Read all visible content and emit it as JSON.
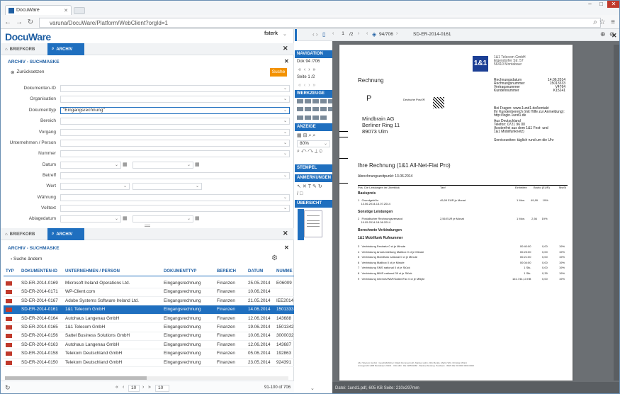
{
  "browser": {
    "tab_title": "DocuWare",
    "url": "varuna/DocuWare/Platform/WebClient?orgId=1"
  },
  "app": {
    "logo": "DocuWare",
    "user": "fsterk"
  },
  "top_tabs": {
    "inbox": "BRIEFKORB",
    "archive": "ARCHIV"
  },
  "search": {
    "title": "ARCHIV - SUCHMASKE",
    "reset": "Zurücksetzen",
    "search_button": "Suche",
    "fields": [
      {
        "label": "Dokumenten-ID",
        "value": ""
      },
      {
        "label": "Organisation",
        "value": ""
      },
      {
        "label": "Dokumenttyp",
        "value": "\"Eingangsrechnung\""
      },
      {
        "label": "Bereich",
        "value": ""
      },
      {
        "label": "Vorgang",
        "value": ""
      },
      {
        "label": "Unternehmen / Person",
        "value": ""
      },
      {
        "label": "Nummer",
        "value": ""
      },
      {
        "label": "Datum",
        "value": ""
      },
      {
        "label": "Betreff",
        "value": ""
      },
      {
        "label": "Wert",
        "value": ""
      },
      {
        "label": "Währung",
        "value": ""
      },
      {
        "label": "Volltext",
        "value": ""
      },
      {
        "label": "Ablagedatum",
        "value": ""
      }
    ]
  },
  "results": {
    "title": "ARCHIV - SUCHMASKE",
    "change_search": "Suche ändern",
    "columns": [
      "TYP",
      "DOKUMENTEN-ID",
      "UNTERNEHMEN / PERSON",
      "DOKUMENTTYP",
      "BEREICH",
      "DATUM",
      "NUMME"
    ],
    "rows": [
      [
        "SD-ER-2014-0169",
        "Microsoft Ireland Operations Ltd.",
        "Eingangsrechnung",
        "Finanzen",
        "25.05.2014",
        "E06009"
      ],
      [
        "SD-ER-2014-0171",
        "WP-Client.com",
        "Eingangsrechnung",
        "Finanzen",
        "10.06.2014",
        ""
      ],
      [
        "SD-ER-2014-0167",
        "Adobe Systems Software Ireland Ltd.",
        "Eingangsrechnung",
        "Finanzen",
        "21.05.2014",
        "IEE2014"
      ],
      [
        "SD-ER-2014-0161",
        "1&1 Telecom GmbH",
        "Eingangsrechnung",
        "Finanzen",
        "14.06.2014",
        "1501333"
      ],
      [
        "SD-ER-2014-0164",
        "Autohaus Langenau GmbH",
        "Eingangsrechnung",
        "Finanzen",
        "12.06.2014",
        "143688"
      ],
      [
        "SD-ER-2014-0165",
        "1&1 Telecom GmbH",
        "Eingangsrechnung",
        "Finanzen",
        "19.06.2014",
        "1501342"
      ],
      [
        "SD-ER-2014-0156",
        "Sattel Business Solutions GmbH",
        "Eingangsrechnung",
        "Finanzen",
        "10.06.2014",
        "3000032"
      ],
      [
        "SD-ER-2014-0163",
        "Autohaus Langenau GmbH",
        "Eingangsrechnung",
        "Finanzen",
        "12.06.2014",
        "143687"
      ],
      [
        "SD-ER-2014-0158",
        "Telekom Deutschland GmbH",
        "Eingangsrechnung",
        "Finanzen",
        "05.06.2014",
        "192863"
      ],
      [
        "SD-ER-2014-0150",
        "Telekom Deutschland GmbH",
        "Eingangsrechnung",
        "Finanzen",
        "23.05.2014",
        "924391"
      ]
    ],
    "selected_index": 3,
    "pager": {
      "page": "10",
      "per_page": "10",
      "count": "91-100 of 706"
    }
  },
  "viewer": {
    "page_input": "1",
    "page_total": "/2",
    "doc_pos": "94/706",
    "doc_id": "SD-ER-2014-0161",
    "status": "Datei: 1und1.pdf, 605 KB Seite: 210x297mm"
  },
  "sidebar": {
    "navigation": "NAVIGATION",
    "doc_label": "Dok",
    "doc_value": "94",
    "doc_total": "/706",
    "page_label": "Seite",
    "page_value": "1",
    "page_total": "/2",
    "tools": "WERKZEUGE",
    "view": "ANZEIGE",
    "zoom": "80%",
    "stamp": "STEMPEL",
    "annotations": "ANMERKUNGEN",
    "overview": "ÜBERSICHT"
  },
  "invoice": {
    "brand": "1&1",
    "title": "Rechnung",
    "recipient_line1": "Mindbrain AG",
    "recipient_line2": "Berliner Ring 11",
    "recipient_line3": "89073 Ulm",
    "heading": "Ihre Rechnung (1&1 All-Net-Flat Pro)",
    "period": "Abrechnungszeitpunkt: 13.06.2014",
    "p_mark": "P"
  }
}
